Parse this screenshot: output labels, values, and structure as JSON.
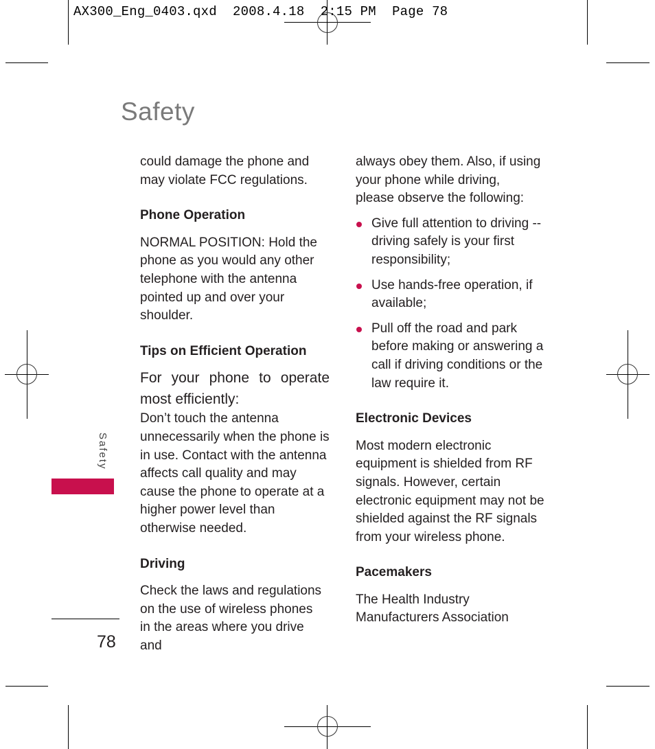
{
  "slug": {
    "text": "AX300_Eng_0403.qxd  2008.4.18  2:15 PM  Page 78"
  },
  "page": {
    "title": "Safety",
    "side_tab_label": "Safety",
    "page_number": "78",
    "accent_color": "#c8104d"
  },
  "left_column": {
    "intro": [
      "could damage the phone and",
      "may violate FCC regulations."
    ],
    "phone_operation": {
      "heading": "Phone Operation",
      "body": "NORMAL POSITION: Hold the phone as you would any other telephone with the antenna pointed up and over your shoulder."
    },
    "tips": {
      "heading": "Tips on Efficient Operation",
      "lead": "For your phone to operate most efficiently:",
      "body": "Don’t touch the antenna unnecessarily when the phone is in use. Contact with the antenna affects call quality and may cause the phone to operate at a higher power level than otherwise needed."
    },
    "driving": {
      "heading": "Driving",
      "body": "Check the laws and regulations on the use of wireless phones in the areas where you drive and"
    }
  },
  "right_column": {
    "driving_cont": "always obey them. Also, if using your phone while driving, please observe the following:",
    "bullets": [
      "Give full attention to driving -- driving safely is your first responsibility;",
      "Use hands-free operation, if available;",
      "Pull off the road and park before making or answering a call if driving conditions or the law require it."
    ],
    "electronic_devices": {
      "heading": "Electronic Devices",
      "body": "Most modern electronic equipment is shielded from RF signals. However, certain electronic equipment may not be shielded against the RF signals from your wireless phone."
    },
    "pacemakers": {
      "heading": "Pacemakers",
      "body": "The Health Industry Manufacturers Association"
    }
  }
}
